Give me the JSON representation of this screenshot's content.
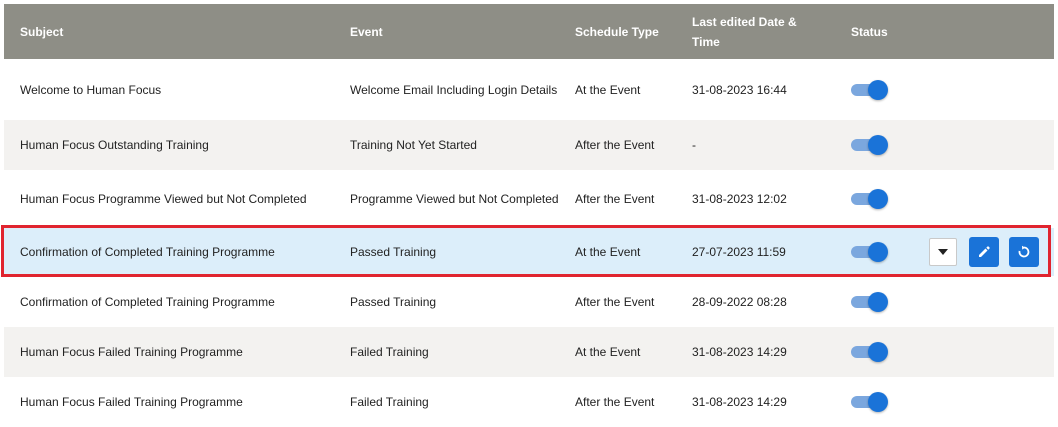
{
  "table": {
    "headers": {
      "subject": "Subject",
      "event": "Event",
      "schedule_type": "Schedule Type",
      "last_edited": "Last edited Date & Time",
      "status": "Status"
    },
    "rows": [
      {
        "subject": "Welcome to Human Focus",
        "event": "Welcome Email Including Login Details",
        "schedule_type": "At the Event",
        "last_edited": "31-08-2023 16:44",
        "status_enabled": true
      },
      {
        "subject": "Human Focus Outstanding Training",
        "event": "Training Not Yet Started",
        "schedule_type": "After the Event",
        "last_edited": "-",
        "status_enabled": true
      },
      {
        "subject": "Human Focus Programme Viewed but Not Completed",
        "event": "Programme Viewed but Not Completed",
        "schedule_type": "After the Event",
        "last_edited": "31-08-2023 12:02",
        "status_enabled": true
      },
      {
        "subject": "Confirmation of Completed Training Programme",
        "event": "Passed Training",
        "schedule_type": "At the Event",
        "last_edited": "27-07-2023 11:59",
        "status_enabled": true,
        "selected": true
      },
      {
        "subject": "Confirmation of Completed Training Programme",
        "event": "Passed Training",
        "schedule_type": "After the Event",
        "last_edited": "28-09-2022 08:28",
        "status_enabled": true
      },
      {
        "subject": "Human Focus Failed Training Programme",
        "event": "Failed Training",
        "schedule_type": "At the Event",
        "last_edited": "31-08-2023 14:29",
        "status_enabled": true
      },
      {
        "subject": "Human Focus Failed Training Programme",
        "event": "Failed Training",
        "schedule_type": "After the Event",
        "last_edited": "31-08-2023 14:29",
        "status_enabled": true
      }
    ],
    "row_actions": {
      "dropdown_icon": "caret-down-icon",
      "edit_icon": "pencil-icon",
      "reset_icon": "reset-icon"
    }
  },
  "colors": {
    "header_bg": "#8e8e86",
    "selected_row_bg": "#dceefa",
    "highlight_border": "#e0242f",
    "accent_blue": "#1a73d8",
    "toggle_track": "#7ba7de"
  }
}
